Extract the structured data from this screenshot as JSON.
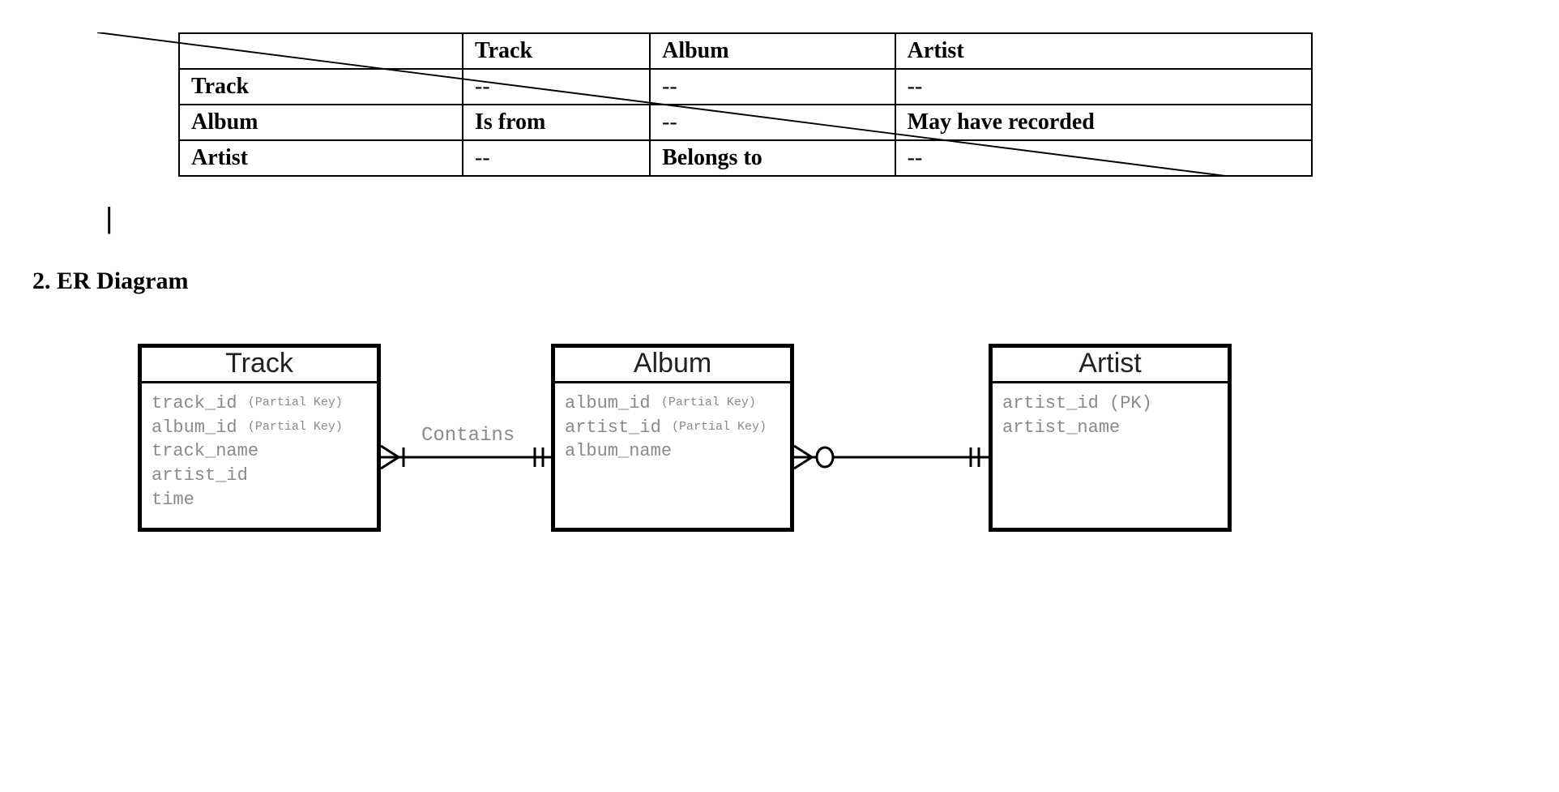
{
  "matrix": {
    "headers": [
      "",
      "Track",
      "Album",
      "Artist"
    ],
    "rows": [
      {
        "label": "Track",
        "cells": [
          "--",
          "--",
          "--"
        ]
      },
      {
        "label": "Album",
        "cells": [
          "Is from",
          "--",
          "May have recorded"
        ]
      },
      {
        "label": "Artist",
        "cells": [
          "--",
          "Belongs to",
          "--"
        ]
      }
    ]
  },
  "cursor": "|",
  "section_title": "2. ER Diagram",
  "er": {
    "entities": [
      {
        "name": "Track",
        "attrs": [
          {
            "text": "track_id",
            "note": "(Partial Key)"
          },
          {
            "text": "album_id",
            "note": "(Partial Key)"
          },
          {
            "text": "track_name",
            "note": ""
          },
          {
            "text": "artist_id",
            "note": ""
          },
          {
            "text": "time",
            "note": ""
          }
        ]
      },
      {
        "name": "Album",
        "attrs": [
          {
            "text": "album_id",
            "note": "(Partial Key)"
          },
          {
            "text": "artist_id",
            "note": "(Partial Key)"
          },
          {
            "text": "album_name",
            "note": ""
          }
        ]
      },
      {
        "name": "Artist",
        "attrs": [
          {
            "text": "artist_id (PK)",
            "note": ""
          },
          {
            "text": "artist_name",
            "note": ""
          }
        ]
      }
    ],
    "relationship_label": "Contains"
  }
}
